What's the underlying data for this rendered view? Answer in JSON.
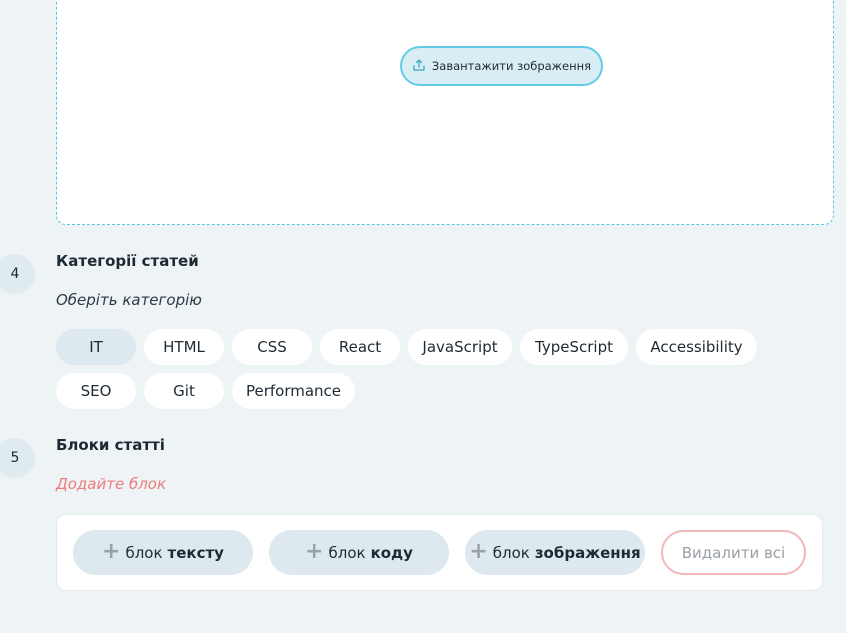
{
  "upload": {
    "button_label": "Завантажити зображення",
    "icon": "upload-icon"
  },
  "categories_section": {
    "step": "4",
    "title": "Категорії статей",
    "hint": "Оберіть категорію",
    "items": [
      {
        "label": "IT",
        "selected": true
      },
      {
        "label": "HTML",
        "selected": false
      },
      {
        "label": "CSS",
        "selected": false
      },
      {
        "label": "React",
        "selected": false
      },
      {
        "label": "JavaScript",
        "selected": false
      },
      {
        "label": "TypeScript",
        "selected": false
      },
      {
        "label": "Accessibility",
        "selected": false
      },
      {
        "label": "SEO",
        "selected": false
      },
      {
        "label": "Git",
        "selected": false
      },
      {
        "label": "Performance",
        "selected": false
      }
    ]
  },
  "blocks_section": {
    "step": "5",
    "title": "Блоки статті",
    "hint": "Додайте блок",
    "buttons": [
      {
        "prefix": "блок",
        "label": "тексту",
        "icon": "plus-icon"
      },
      {
        "prefix": "блок",
        "label": "коду",
        "icon": "plus-icon"
      },
      {
        "prefix": "блок",
        "label": "зображення",
        "icon": "plus-icon"
      }
    ],
    "delete_label": "Видалити всі"
  },
  "colors": {
    "background": "#eef3f5",
    "accent": "#62cbe8",
    "chip_selected": "#dde9ee",
    "warning_text": "#ee7c7c"
  }
}
